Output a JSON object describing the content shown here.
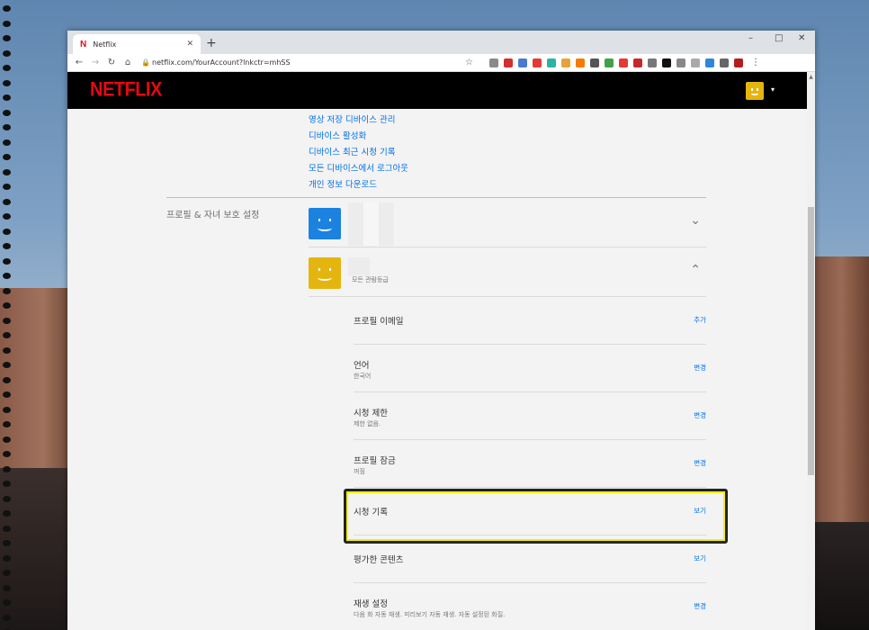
{
  "browser": {
    "tab_title": "Netflix",
    "tab_favicon": "N",
    "url": "netflix.com/YourAccount?lnkctr=mhSS",
    "minimize_glyph": "–",
    "maximize_glyph": "□",
    "close_glyph": "✕",
    "new_tab_glyph": "+",
    "tab_close_glyph": "✕",
    "back_glyph": "←",
    "forward_glyph": "→",
    "reload_glyph": "↻",
    "home_glyph": "⌂",
    "lock_glyph": "🔒",
    "star_glyph": "☆",
    "menu_glyph": "⋮",
    "extension_colors": [
      "#8a8a8a",
      "#d32f2f",
      "#4a7bd0",
      "#e53935",
      "#2bb3a3",
      "#e8a23a",
      "#f57c00",
      "#555555",
      "#43a047",
      "#e53935",
      "#c62828",
      "#777777",
      "#111111",
      "#888888",
      "#aaaaaa",
      "#2e86de",
      "#666666",
      "#b71c1c"
    ]
  },
  "netflix": {
    "logo": "NETFLIX",
    "avatar_color": "#e5b50f",
    "caret": "▾"
  },
  "account_links": [
    "영상 저장 디바이스 관리",
    "디바이스 활성화",
    "디바이스 최근 시청 기록",
    "모든 디바이스에서 로그아웃",
    "개인 정보 다운로드"
  ],
  "section_label": "프로필 & 자녀 보호 설정",
  "profiles": [
    {
      "avatar_color": "#1b82e0",
      "subtitle": "",
      "chevron": "⌄"
    },
    {
      "avatar_color": "#e5b50f",
      "subtitle": "모든 관람등급",
      "chevron": "⌃"
    }
  ],
  "settings": [
    {
      "title": "프로필 이메일",
      "desc": "",
      "action": "추가"
    },
    {
      "title": "언어",
      "desc": "한국어",
      "action": "변경"
    },
    {
      "title": "시청 제한",
      "desc": "제한 없음.",
      "action": "변경"
    },
    {
      "title": "프로필 잠금",
      "desc": "꺼짐",
      "action": "변경"
    },
    {
      "title": "시청 기록",
      "desc": "",
      "action": "보기"
    },
    {
      "title": "평가한 콘텐츠",
      "desc": "",
      "action": "보기"
    },
    {
      "title": "재생 설정",
      "desc": "다음 화 자동 재생. 미리보기 자동 재생. 자동 설정된 화질.",
      "action": "변경"
    }
  ],
  "colors": {
    "link": "#0071eb",
    "highlight": "#f5f000"
  }
}
